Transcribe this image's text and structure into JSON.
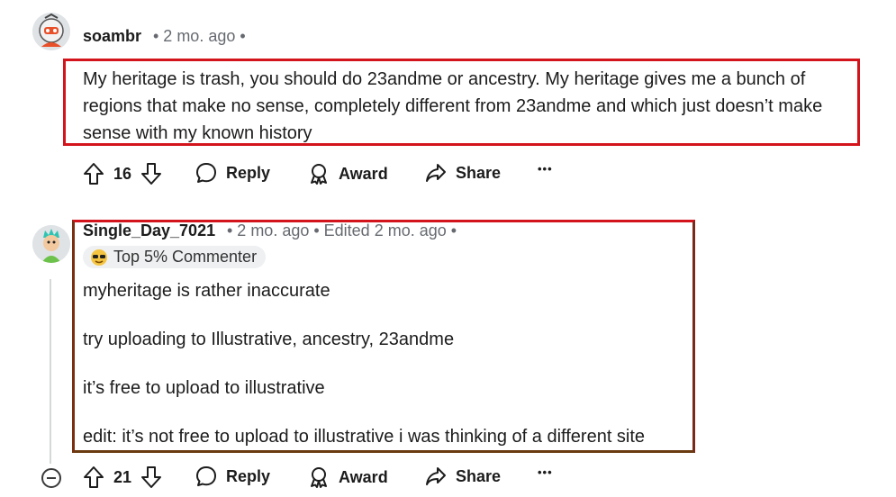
{
  "comments": [
    {
      "username": "soambr",
      "meta": "• 2 mo. ago •",
      "body": [
        "My heritage is trash, you should do 23andme or ancestry. My heritage gives me a bunch of regions that make no sense, completely different from 23andme and which just doesn’t make sense with my known history"
      ],
      "votes": "16",
      "actions": {
        "reply": "Reply",
        "award": "Award",
        "share": "Share",
        "more": "•••"
      }
    },
    {
      "username": "Single_Day_7021",
      "meta": "• 2 mo. ago • Edited 2 mo. ago •",
      "badge": "Top 5% Commenter",
      "body": [
        "myheritage is rather inaccurate",
        "try uploading to Illustrative, ancestry, 23andme",
        "it’s free to upload to illustrative",
        "edit: it’s not free to upload to illustrative i was thinking of a different site"
      ],
      "votes": "21",
      "actions": {
        "reply": "Reply",
        "award": "Award",
        "share": "Share",
        "more": "•••"
      }
    }
  ],
  "colors": {
    "highlight": "#d4141c",
    "text": "#1c1c1c",
    "meta": "#666a70"
  }
}
